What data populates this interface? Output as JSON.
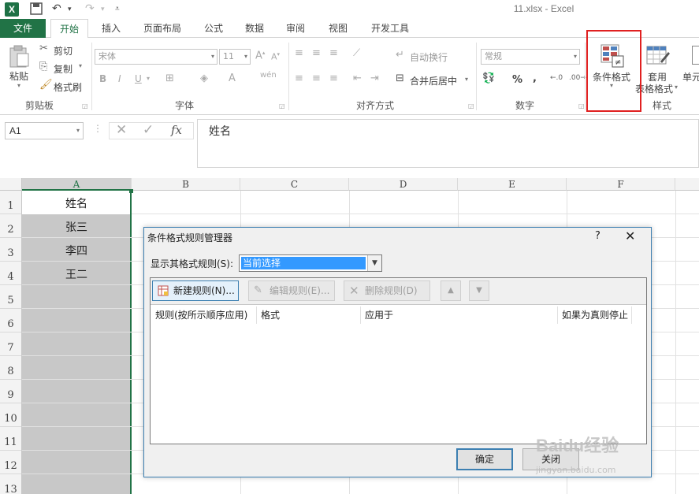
{
  "window": {
    "title": "11.xlsx - Excel"
  },
  "ribbon_tabs": [
    "文件",
    "开始",
    "插入",
    "页面布局",
    "公式",
    "数据",
    "审阅",
    "视图",
    "开发工具"
  ],
  "clipboard": {
    "paste": "粘贴",
    "cut": "剪切",
    "copy": "复制",
    "format_painter": "格式刷",
    "group": "剪贴板"
  },
  "font": {
    "name": "宋体",
    "size": "11",
    "bold": "B",
    "italic": "I",
    "underline": "U",
    "group": "字体"
  },
  "alignment": {
    "wrap_text": "自动换行",
    "merge_center": "合并后居中",
    "group": "对齐方式"
  },
  "number": {
    "format": "常规",
    "percent": "%",
    "comma": ",",
    "group": "数字"
  },
  "styles": {
    "conditional_format": "条件格式",
    "format_as_table_1": "套用",
    "format_as_table_2": "表格格式",
    "cell_styles": "单元",
    "group": "样式"
  },
  "formula_bar": {
    "name_box": "A1",
    "fx": "fx",
    "content": "姓名"
  },
  "grid": {
    "columns": [
      "A",
      "B",
      "C",
      "D",
      "E",
      "F"
    ],
    "rows": [
      "1",
      "2",
      "3",
      "4",
      "5",
      "6",
      "7",
      "8",
      "9",
      "10",
      "11",
      "12",
      "13"
    ],
    "column_a": [
      "姓名",
      "张三",
      "李四",
      "王二"
    ]
  },
  "dialog": {
    "title": "条件格式规则管理器",
    "help": "?",
    "close": "✕",
    "show_rules_label": "显示其格式规则(S):",
    "show_rules_value": "当前选择",
    "new_rule": "新建规则(N)...",
    "edit_rule": "编辑规则(E)...",
    "delete_rule": "删除规则(D)",
    "columns": [
      "规则(按所示顺序应用)",
      "格式",
      "应用于",
      "如果为真则停止"
    ],
    "ok": "确定",
    "close_button": "关闭"
  },
  "watermark": {
    "text": "Baidu经验",
    "sub": "jingyan.baidu.com"
  },
  "colors": {
    "excel_green": "#217346",
    "highlight_red": "#e02020",
    "selection_blue": "#3399ff"
  }
}
